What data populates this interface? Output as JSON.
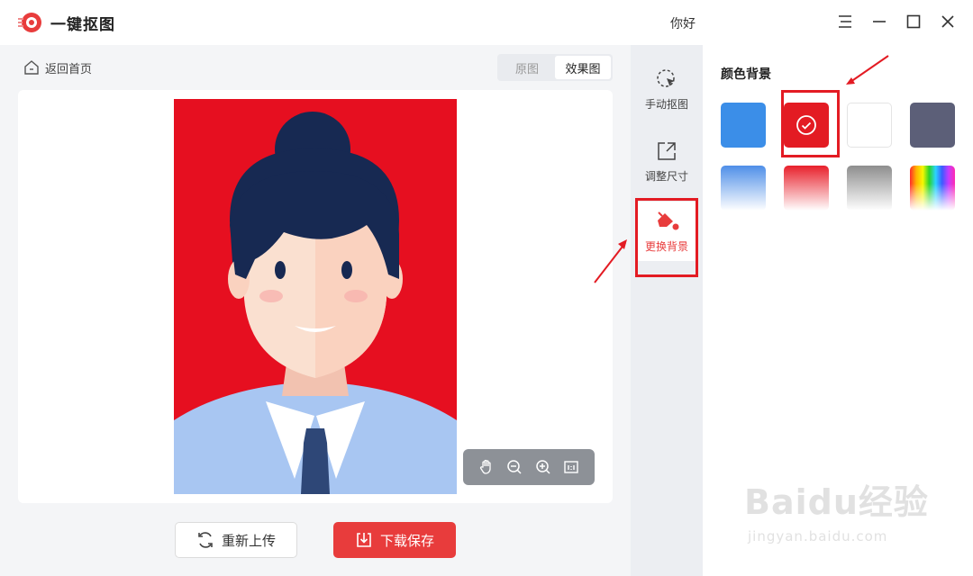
{
  "app": {
    "name": "一键抠图",
    "greeting": "你好"
  },
  "left": {
    "back_label": "返回首页",
    "tabs": [
      {
        "label": "原图",
        "active": false
      },
      {
        "label": "效果图",
        "active": true
      }
    ],
    "background_color": "#e60f20",
    "buttons": {
      "upload_label": "重新上传",
      "save_label": "下载保存"
    }
  },
  "tools": [
    {
      "label": "手动抠图",
      "icon": "cursor-icon",
      "active": false
    },
    {
      "label": "调整尺寸",
      "icon": "resize-icon",
      "active": false
    },
    {
      "label": "更换背景",
      "icon": "paint-bucket-icon",
      "active": true
    }
  ],
  "panel": {
    "title": "颜色背景",
    "swatches": [
      {
        "name": "blue",
        "color": "#3b8ee8",
        "selected": false
      },
      {
        "name": "red",
        "color": "#e31b23",
        "selected": true
      },
      {
        "name": "white",
        "color": "#ffffff",
        "selected": false
      },
      {
        "name": "gray",
        "color": "#5c5f78",
        "selected": false
      },
      {
        "name": "blue-gradient",
        "color": "#5592ea",
        "selected": false
      },
      {
        "name": "red-gradient",
        "color": "#e8202b",
        "selected": false
      },
      {
        "name": "gray-gradient",
        "color": "#9a9a9a",
        "selected": false
      },
      {
        "name": "rainbow",
        "color": "rainbow",
        "selected": false
      }
    ]
  },
  "watermark": {
    "text": "Baidu经验",
    "sub": "jingyan.baidu.com"
  }
}
